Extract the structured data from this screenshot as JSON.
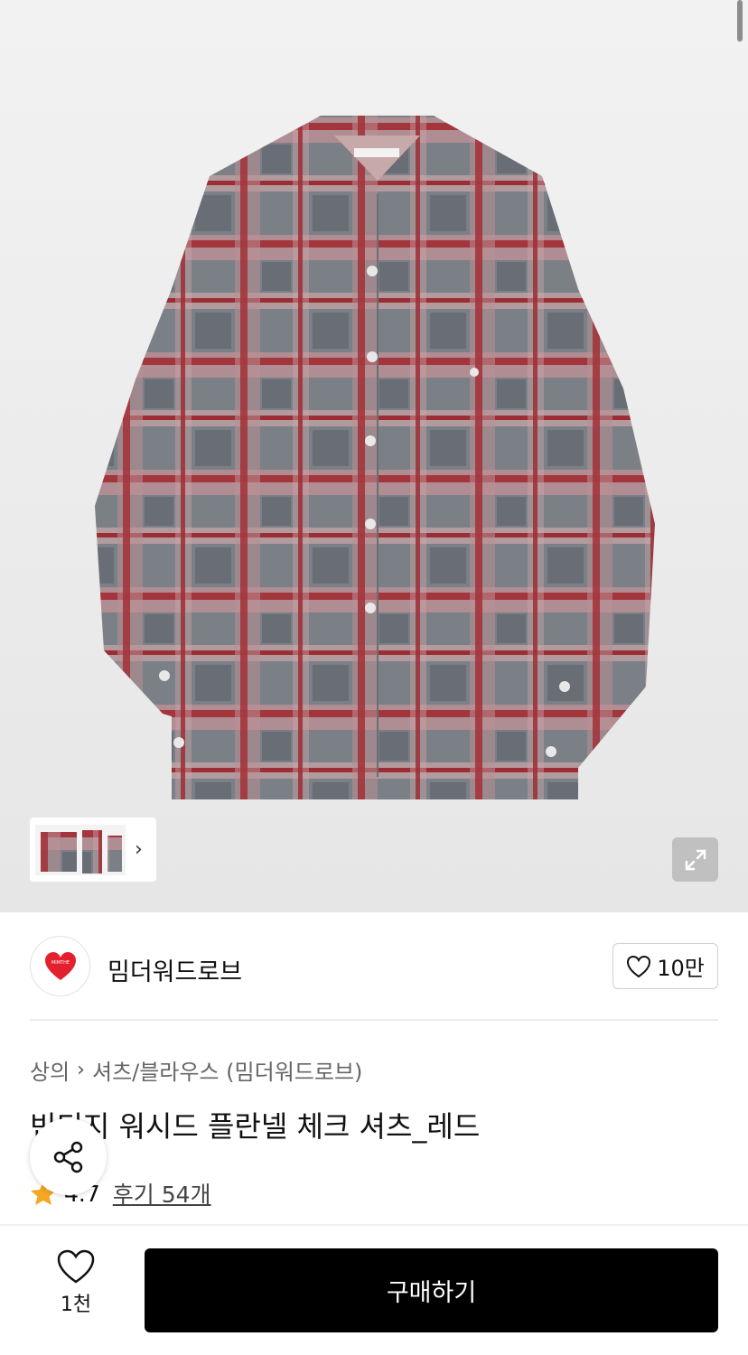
{
  "product": {
    "image_alt": "",
    "thumbnail_count_icon": "chevron-right-icon"
  },
  "brand": {
    "name": "밈더워드로브",
    "logo_text": "MIMTHE",
    "like_count": "10만"
  },
  "breadcrumb": {
    "category": "상의",
    "subcategory": "셔츠/블라우스 (밈더워드로브)"
  },
  "title": "빈티지 워시드 플란넬 체크 셔츠_레드",
  "rating": {
    "score": "4.7",
    "reviews": "후기 54개"
  },
  "actions": {
    "wish_count": "1천",
    "buy_label": "구매하기"
  },
  "colors": {
    "accent": "#000000",
    "star": "#f5a623",
    "logo_red": "#e5202e"
  }
}
